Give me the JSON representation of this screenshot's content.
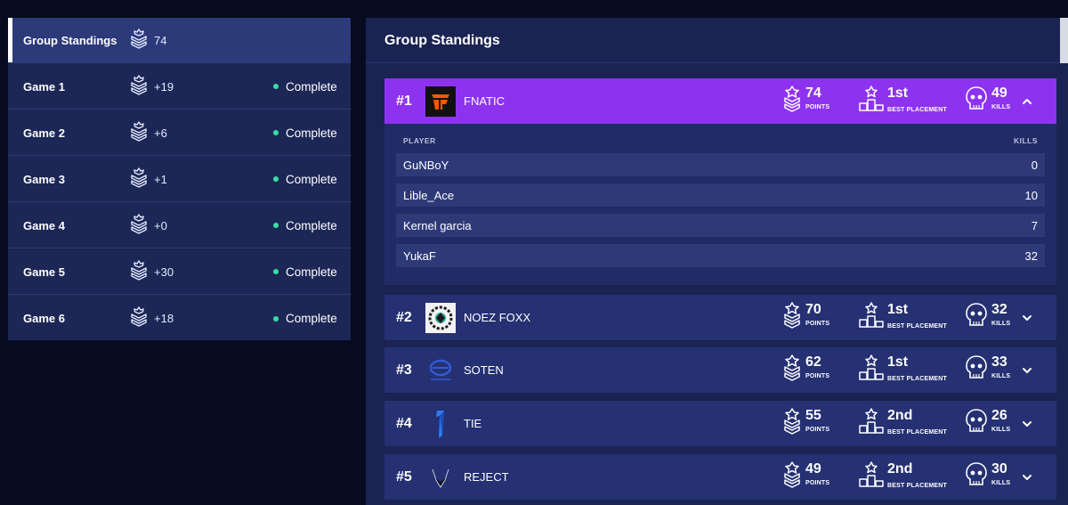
{
  "sidebar": {
    "items": [
      {
        "label": "Group Standings",
        "points": "74",
        "status": "",
        "active": true
      },
      {
        "label": "Game 1",
        "points": "+19",
        "status": "Complete"
      },
      {
        "label": "Game 2",
        "points": "+6",
        "status": "Complete"
      },
      {
        "label": "Game 3",
        "points": "+1",
        "status": "Complete"
      },
      {
        "label": "Game 4",
        "points": "+0",
        "status": "Complete"
      },
      {
        "label": "Game 5",
        "points": "+30",
        "status": "Complete"
      },
      {
        "label": "Game 6",
        "points": "+18",
        "status": "Complete"
      }
    ]
  },
  "main": {
    "title": "Group Standings",
    "stat_labels": {
      "points": "POINTS",
      "placement": "BEST PLACEMENT",
      "kills": "KILLS"
    },
    "player_table": {
      "col_player": "PLAYER",
      "col_kills": "KILLS"
    },
    "teams": [
      {
        "rank": "#1",
        "name": "FNATIC",
        "points": "74",
        "best_placement": "1st",
        "kills": "49",
        "logo_icon": "fnatic-logo",
        "expanded": true,
        "players": [
          {
            "name": "GuNBoY",
            "kills": "0"
          },
          {
            "name": "Lible_Ace",
            "kills": "10"
          },
          {
            "name": "Kernel garcia",
            "kills": "7"
          },
          {
            "name": "YukaF",
            "kills": "32"
          }
        ]
      },
      {
        "rank": "#2",
        "name": "NOEZ FOXX",
        "points": "70",
        "best_placement": "1st",
        "kills": "32",
        "logo_icon": "noez-foxx-logo"
      },
      {
        "rank": "#3",
        "name": "SOTEN",
        "points": "62",
        "best_placement": "1st",
        "kills": "33",
        "logo_icon": "soten-logo"
      },
      {
        "rank": "#4",
        "name": "TIE",
        "points": "55",
        "best_placement": "2nd",
        "kills": "26",
        "logo_icon": "tie-logo"
      },
      {
        "rank": "#5",
        "name": "REJECT",
        "points": "49",
        "best_placement": "2nd",
        "kills": "30",
        "logo_icon": "reject-logo"
      }
    ]
  },
  "colors": {
    "background": "#060b1f",
    "panel": "#1a2352",
    "card": "#253172",
    "expanded_card": "#8d33f0",
    "status_complete": "#35e0a1",
    "fnatic_orange": "#ff5900"
  }
}
